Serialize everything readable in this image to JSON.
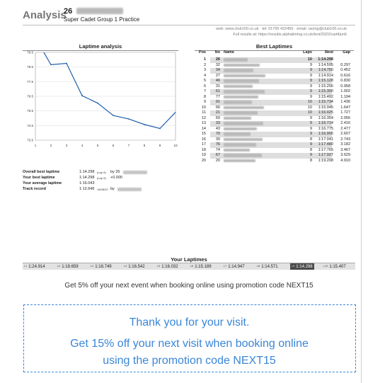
{
  "header": {
    "title": "Analysis",
    "kart_number": "26",
    "event": "Super Cadet Group 1 Practice",
    "contact": "web: www.club100.co.uk · tel: 01795 422455 · email: racing@club100.co.uk",
    "results_line": "Full results at: https://results.alphatiming.co.uk/test/2022/cad4jun5"
  },
  "chart_data": {
    "type": "line",
    "title": "Laptime analysis",
    "x": [
      1,
      2,
      3,
      4,
      5,
      6,
      7,
      8,
      9,
      10
    ],
    "series": [
      {
        "values": [
          80.5,
          78.659,
          78.749,
          76.542,
          76.032,
          75.189,
          74.947,
          74.571,
          74.298,
          75.407
        ]
      }
    ],
    "xticks": [
      "1",
      "2",
      "3",
      "4",
      "5",
      "6",
      "7",
      "8",
      "9",
      "10"
    ],
    "yticks": [
      "73.5",
      "74.5",
      "75.5",
      "76.5",
      "77.5",
      "78.5",
      "79.5"
    ],
    "ylim": [
      73.5,
      79.5
    ],
    "xlim": [
      1,
      10
    ],
    "grid": true,
    "color": "#1f5fa8"
  },
  "stats": {
    "overall": {
      "label": "Overall best laptime",
      "value": "1:14.298",
      "lap": "(Lap 9)",
      "extra": "by 26"
    },
    "yours": {
      "label": "Your best laptime",
      "value": "1:14.298",
      "lap": "(Lap 9)",
      "extra": "+0.000"
    },
    "average": {
      "label": "Your average laptime",
      "value": "1:16.043"
    },
    "record": {
      "label": "Track record",
      "value": "1:12.646",
      "lap": "14/08/22",
      "extra": "by"
    }
  },
  "best_laptimes": {
    "title": "Best Laptimes",
    "headers": {
      "pos": "Pos",
      "no": "No",
      "name": "Name",
      "laps": "Laps",
      "best": "Best",
      "gap": "Gap"
    },
    "rows": [
      {
        "pos": "1",
        "no": "26",
        "laps": "10",
        "best": "1:14.298",
        "gap": ""
      },
      {
        "pos": "2",
        "no": "32",
        "laps": "9",
        "best": "1:14.595",
        "gap": "0.297"
      },
      {
        "pos": "3",
        "no": "34",
        "laps": "9",
        "best": "1:14.750",
        "gap": "0.452"
      },
      {
        "pos": "4",
        "no": "27",
        "laps": "9",
        "best": "1:14.914",
        "gap": "0.616"
      },
      {
        "pos": "5",
        "no": "46",
        "laps": "9",
        "best": "1:15.128",
        "gap": "0.830"
      },
      {
        "pos": "6",
        "no": "31",
        "laps": "9",
        "best": "1:15.256",
        "gap": "0.958"
      },
      {
        "pos": "7",
        "no": "61",
        "laps": "9",
        "best": "1:15.300",
        "gap": "1.002"
      },
      {
        "pos": "8",
        "no": "77",
        "laps": "9",
        "best": "1:15.492",
        "gap": "1.194"
      },
      {
        "pos": "9",
        "no": "91",
        "laps": "10",
        "best": "1:15.734",
        "gap": "1.436"
      },
      {
        "pos": "10",
        "no": "66",
        "laps": "10",
        "best": "1:15.945",
        "gap": "1.647"
      },
      {
        "pos": "11",
        "no": "21",
        "laps": "10",
        "best": "1:16.025",
        "gap": "1.727"
      },
      {
        "pos": "12",
        "no": "60",
        "laps": "9",
        "best": "1:16.354",
        "gap": "2.056"
      },
      {
        "pos": "13",
        "no": "33",
        "laps": "9",
        "best": "1:16.714",
        "gap": "2.416"
      },
      {
        "pos": "14",
        "no": "43",
        "laps": "9",
        "best": "1:16.775",
        "gap": "2.477"
      },
      {
        "pos": "15",
        "no": "70",
        "laps": "9",
        "best": "1:16.905",
        "gap": "2.607"
      },
      {
        "pos": "16",
        "no": "30",
        "laps": "8",
        "best": "1:17.041",
        "gap": "2.743"
      },
      {
        "pos": "17",
        "no": "76",
        "laps": "9",
        "best": "1:17.480",
        "gap": "3.182"
      },
      {
        "pos": "18",
        "no": "74",
        "laps": "8",
        "best": "1:17.765",
        "gap": "3.467"
      },
      {
        "pos": "19",
        "no": "67",
        "laps": "9",
        "best": "1:17.927",
        "gap": "3.629"
      },
      {
        "pos": "20",
        "no": "20",
        "laps": "8",
        "best": "1:19.208",
        "gap": "4.910"
      }
    ]
  },
  "your_laptimes": {
    "title": "Your Laptimes",
    "laps": [
      {
        "n": "L1",
        "t": "1:24.914"
      },
      {
        "n": "L2",
        "t": "1:18.659"
      },
      {
        "n": "L3",
        "t": "1:18.749"
      },
      {
        "n": "L4",
        "t": "1:16.542"
      },
      {
        "n": "L5",
        "t": "1:16.032"
      },
      {
        "n": "L6",
        "t": "1:15.189"
      },
      {
        "n": "L7",
        "t": "1:14.947"
      },
      {
        "n": "L8",
        "t": "1:14.571"
      },
      {
        "n": "L9",
        "t": "1:14.298",
        "best": true
      },
      {
        "n": "L10",
        "t": "1:15.407"
      }
    ]
  },
  "promo": {
    "five": "Get 5% off your next event when booking online using promotion code NEXT15",
    "thanks": "Thank you for your visit.",
    "fifteen_1": "Get 15% off your next visit when booking online",
    "fifteen_2": "using the promotion code NEXT15"
  }
}
